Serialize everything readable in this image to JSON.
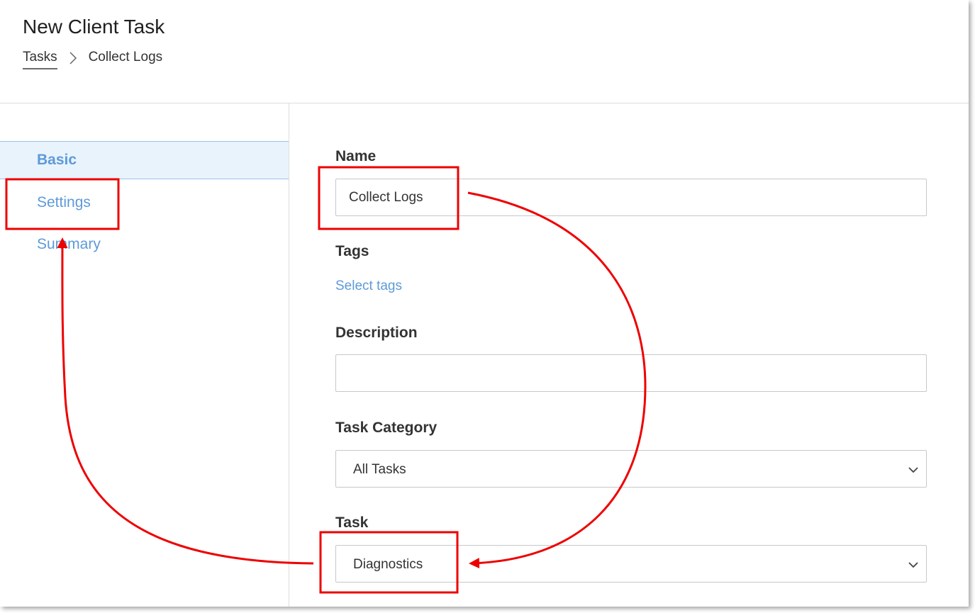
{
  "header": {
    "title": "New Client Task",
    "breadcrumb": {
      "parent": "Tasks",
      "current": "Collect Logs"
    }
  },
  "sidebar": {
    "items": [
      {
        "label": "Basic",
        "active": true
      },
      {
        "label": "Settings",
        "active": false
      },
      {
        "label": "Summary",
        "active": false
      }
    ]
  },
  "form": {
    "name": {
      "label": "Name",
      "value": "Collect Logs"
    },
    "tags": {
      "label": "Tags",
      "link": "Select tags"
    },
    "description": {
      "label": "Description",
      "value": ""
    },
    "task_category": {
      "label": "Task Category",
      "selected": "All Tasks"
    },
    "task": {
      "label": "Task",
      "selected": "Diagnostics"
    }
  },
  "colors": {
    "accent": "#5e9ad8",
    "active_bg": "#e9f3fc",
    "annotation": "#ee0000"
  },
  "icons": [
    "chevron-right-icon",
    "chevron-down-icon"
  ]
}
